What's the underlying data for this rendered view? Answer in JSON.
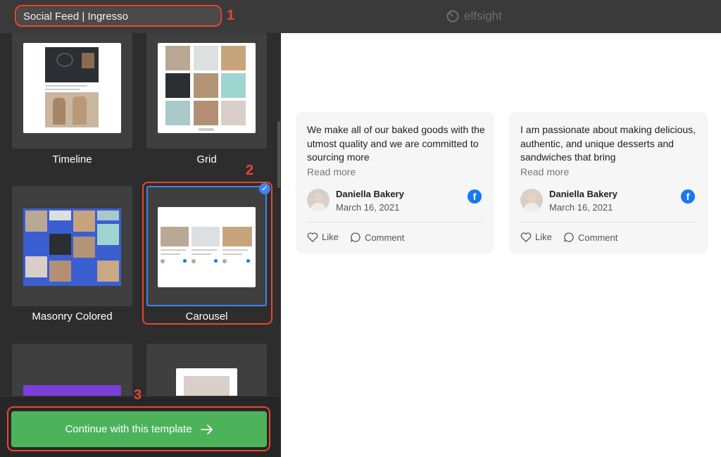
{
  "header": {
    "widget_name": "Social Feed | Ingresso",
    "brand": "elfsight",
    "brand_icon": "elfsight-logo-icon"
  },
  "templates": [
    {
      "label": "Timeline"
    },
    {
      "label": "Grid"
    },
    {
      "label": "Masonry Colored"
    },
    {
      "label": "Carousel",
      "selected": true
    },
    {
      "label": ""
    },
    {
      "label": ""
    }
  ],
  "callouts": [
    "1",
    "2",
    "3"
  ],
  "footer": {
    "continue_label": "Continue with this template",
    "continue_icon": "arrow-right-icon"
  },
  "posts": [
    {
      "text": "We make all of our baked goods with the utmost quality and we are committed to sourcing more",
      "read_more": "Read more",
      "author": "Daniella Bakery",
      "date": "March 16, 2021",
      "like": "Like",
      "comment": "Comment"
    },
    {
      "text": "I am passionate about making delicious, authentic, and unique desserts and sandwiches that bring",
      "read_more": "Read more",
      "author": "Daniella Bakery",
      "date": "March 16, 2021",
      "like": "Like",
      "comment": "Comment"
    }
  ],
  "colors": {
    "accent": "#4cb35b",
    "callout": "#e8472d",
    "selected": "#3b86ea",
    "facebook": "#1877f2"
  }
}
